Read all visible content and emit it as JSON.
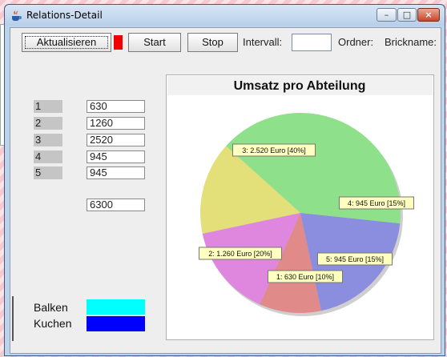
{
  "window": {
    "title": "Relations-Detail",
    "controls": {
      "minimize": "–",
      "maximize": "□",
      "close": "×"
    }
  },
  "toolbar": {
    "refresh_label": "Aktualisieren",
    "start_label": "Start",
    "stop_label": "Stop",
    "interval_label": "Intervall:",
    "interval_value": "",
    "folder_label": "Ordner:",
    "brickname_label": "Brickname:"
  },
  "list": {
    "rows": [
      {
        "index": "1",
        "value": "630"
      },
      {
        "index": "2",
        "value": "1260"
      },
      {
        "index": "3",
        "value": "2520"
      },
      {
        "index": "4",
        "value": "945"
      },
      {
        "index": "5",
        "value": "945"
      }
    ],
    "total": "6300"
  },
  "legend": {
    "bar_label": "Balken",
    "bar_color": "#00ffff",
    "pie_label": "Kuchen",
    "pie_color": "#0000ff"
  },
  "colors": {
    "indicator": "#f00000"
  },
  "chart_data": {
    "type": "pie",
    "title": "Umsatz pro Abteilung",
    "slices": [
      {
        "label": "1: 630 Euro [10%]",
        "value": 630,
        "percent": 10,
        "color": "#e08a8a"
      },
      {
        "label": "2: 1.260 Euro [20%]",
        "value": 1260,
        "percent": 20,
        "color": "#8b8ddf"
      },
      {
        "label": "3: 2.520 Euro [40%]",
        "value": 2520,
        "percent": 40,
        "color": "#8fe08b"
      },
      {
        "label": "4: 945 Euro [15%]",
        "value": 945,
        "percent": 15,
        "color": "#e3e07a"
      },
      {
        "label": "5: 945 Euro [15%]",
        "value": 945,
        "percent": 15,
        "color": "#df86df"
      }
    ]
  }
}
